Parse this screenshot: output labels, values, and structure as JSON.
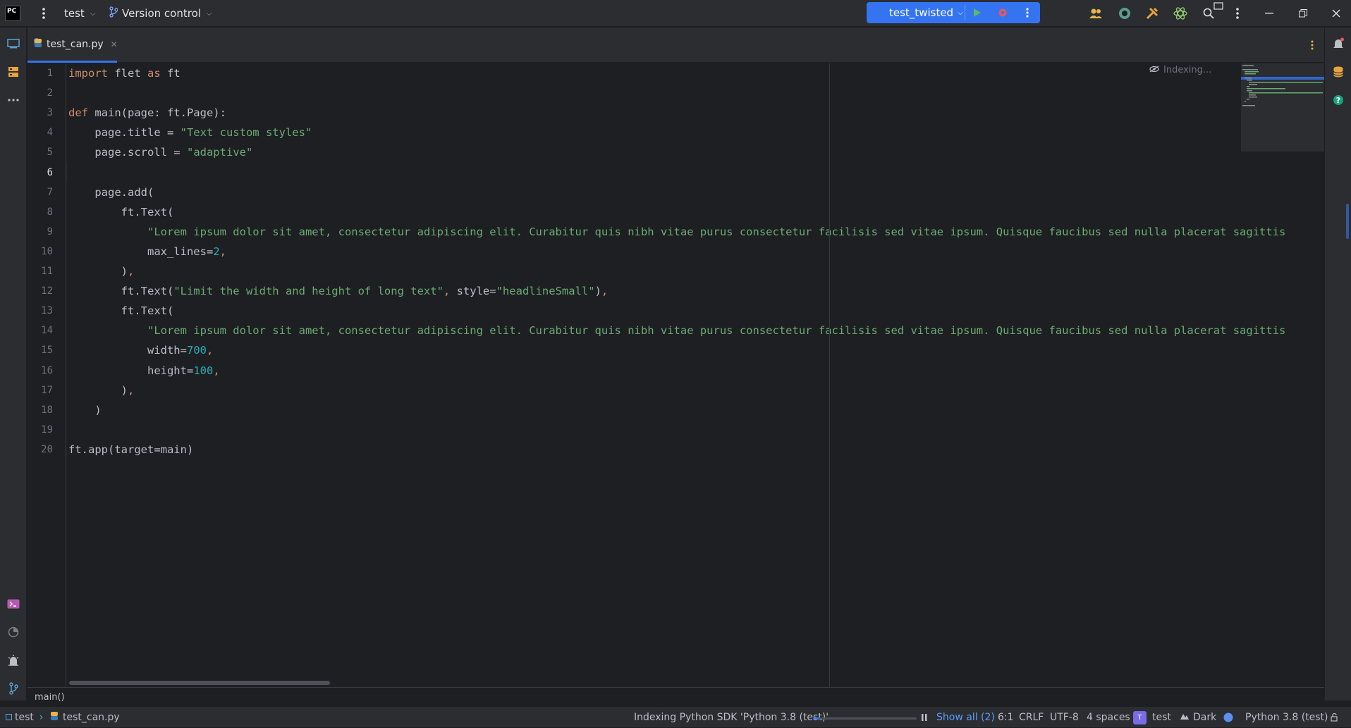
{
  "titlebar": {
    "logo_text": "PC",
    "project": "test",
    "vcs": "Version control",
    "run_config": "test_twisted"
  },
  "tab": {
    "filename": "test_can.py"
  },
  "editor": {
    "indexing": "Indexing...",
    "lines": [
      {
        "n": "1",
        "html": "<span class='kw'>import</span> flet <span class='kw'>as</span> ft"
      },
      {
        "n": "2",
        "html": ""
      },
      {
        "n": "3",
        "html": "<span class='kw'>def</span> main(page: ft.Page):"
      },
      {
        "n": "4",
        "html": "    page.title = <span class='str'>\"Text custom styles\"</span>"
      },
      {
        "n": "5",
        "html": "    page.scroll = <span class='str'>\"adaptive\"</span>"
      },
      {
        "n": "6",
        "html": ""
      },
      {
        "n": "7",
        "html": "    page.add("
      },
      {
        "n": "8",
        "html": "        ft.Text("
      },
      {
        "n": "9",
        "html": "            <span class='str'>\"Lorem ipsum dolor sit amet, consectetur adipiscing elit. Curabitur quis nibh vitae purus consectetur facilisis sed vitae ipsum. Quisque faucibus sed nulla placerat sagittis</span>"
      },
      {
        "n": "10",
        "html": "            max_lines=<span class='num'>2</span><span class='kw'>,</span>"
      },
      {
        "n": "11",
        "html": "        )<span class='kw'>,</span>"
      },
      {
        "n": "12",
        "html": "        ft.Text(<span class='str'>\"Limit the width and height of long text\"</span><span class='kw'>,</span> style=<span class='str'>\"headlineSmall\"</span>)<span class='kw'>,</span>"
      },
      {
        "n": "13",
        "html": "        ft.Text("
      },
      {
        "n": "14",
        "html": "            <span class='str'>\"Lorem ipsum dolor sit amet, consectetur adipiscing elit. Curabitur quis nibh vitae purus consectetur facilisis sed vitae ipsum. Quisque faucibus sed nulla placerat sagittis</span>"
      },
      {
        "n": "15",
        "html": "            width=<span class='num'>700</span><span class='kw'>,</span>"
      },
      {
        "n": "16",
        "html": "            height=<span class='num'>100</span><span class='kw'>,</span>"
      },
      {
        "n": "17",
        "html": "        )<span class='kw'>,</span>"
      },
      {
        "n": "18",
        "html": "    )"
      },
      {
        "n": "19",
        "html": ""
      },
      {
        "n": "20",
        "html": "ft.app(target=main)"
      }
    ]
  },
  "breadcrumb": "main()",
  "statusbar": {
    "project": "test",
    "file": "test_can.py",
    "task": "Indexing Python SDK 'Python 3.8 (test)'",
    "show_all": "Show all (2)",
    "position": "6:1",
    "line_sep": "CRLF",
    "encoding": "UTF-8",
    "indent": "4 spaces",
    "venv_badge": "T",
    "venv": "test",
    "theme": "Dark",
    "interpreter": "Python 3.8 (test)"
  },
  "colors": {
    "accent": "#3574f0",
    "keyword": "#cf8e6d",
    "string": "#6aab73",
    "number": "#2aacb8"
  }
}
